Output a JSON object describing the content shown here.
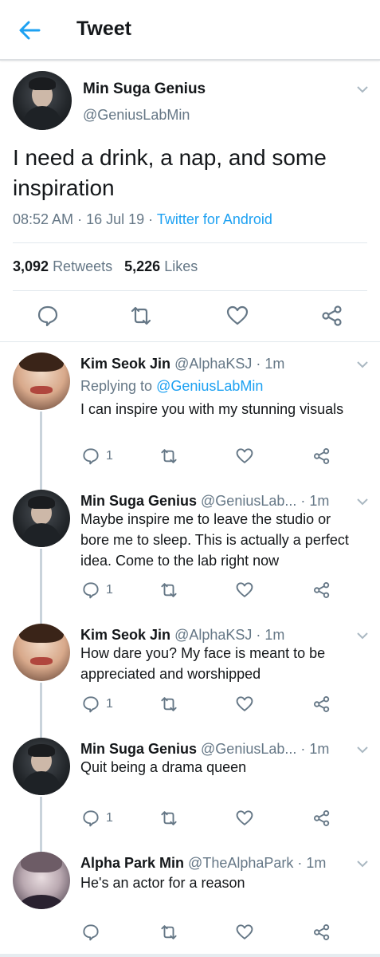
{
  "header": {
    "title": "Tweet",
    "back_icon": "back-arrow-icon"
  },
  "tweet": {
    "name": "Min Suga Genius",
    "handle": "@GeniusLabMin",
    "text": "I need a drink, a nap, and some inspiration",
    "time": "08:52 AM",
    "date": "16 Jul 19",
    "source": "Twitter for Android",
    "retweets_count": "3,092",
    "retweets_label": "Retweets",
    "likes_count": "5,226",
    "likes_label": "Likes"
  },
  "replies": [
    {
      "name": "Kim Seok Jin",
      "handle": "@AlphaKSJ",
      "time": "1m",
      "replying_to_label": "Replying to",
      "replying_to": "@GeniusLabMin",
      "text": "I can inspire you with my stunning visuals",
      "reply_count": "1"
    },
    {
      "name": "Min Suga Genius",
      "handle": "@GeniusLab...",
      "time": "1m",
      "text": "Maybe inspire me to leave the studio or bore me to sleep. This is actually a perfect idea. Come to the lab right now",
      "reply_count": "1"
    },
    {
      "name": "Kim Seok Jin",
      "handle": "@AlphaKSJ",
      "time": "1m",
      "text": "How dare you? My face is meant to be appreciated and worshipped",
      "reply_count": "1"
    },
    {
      "name": "Min Suga Genius",
      "handle": "@GeniusLab...",
      "time": "1m",
      "text": "Quit being a drama queen",
      "reply_count": "1"
    },
    {
      "name": "Alpha Park Min",
      "handle": "@TheAlphaPark",
      "time": "1m",
      "text": "He's an actor for a reason",
      "reply_count": ""
    }
  ],
  "colors": {
    "accent": "#1da1f2",
    "secondary_text": "#657786",
    "divider": "#e1e8ed"
  }
}
